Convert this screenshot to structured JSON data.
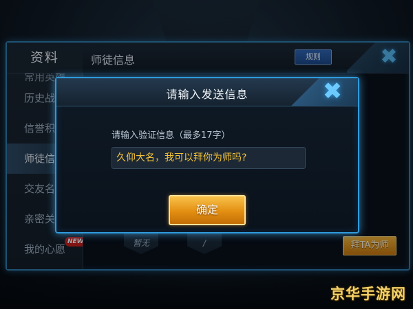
{
  "main": {
    "title": "资料",
    "section_title": "师徒信息",
    "rules_label": "规则",
    "sidebar": {
      "items": [
        {
          "label": "常用英雄",
          "state": "cut"
        },
        {
          "label": "历史战绩",
          "state": "normal"
        },
        {
          "label": "信誉积分",
          "state": "normal"
        },
        {
          "label": "师徒信息",
          "state": "active"
        },
        {
          "label": "交友名片",
          "state": "normal"
        },
        {
          "label": "亲密关系",
          "state": "normal"
        },
        {
          "label": "我的心愿",
          "state": "normal",
          "badge": "NEW"
        }
      ]
    },
    "emblems": [
      "暂无",
      "/"
    ],
    "apprentice_button": "拜TA为师"
  },
  "dialog": {
    "title": "请输入发送信息",
    "prompt": "请输入验证信息（最多17字）",
    "input_value": "久仰大名，我可以拜你为师吗?",
    "confirm_label": "确定"
  },
  "watermark": "京华手游网",
  "colors": {
    "accent_blue": "#2f9bdc",
    "gold_button": "#e38f12",
    "input_text": "#f2c23a",
    "badge_red": "#c8201e"
  },
  "icons": {
    "close": "close-x-icon"
  }
}
